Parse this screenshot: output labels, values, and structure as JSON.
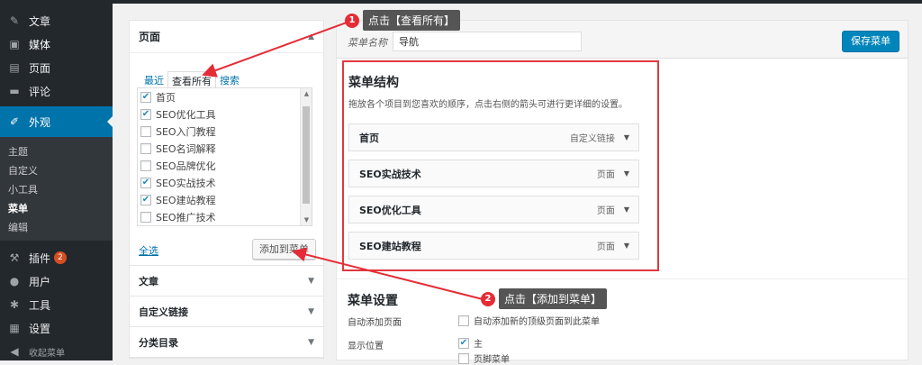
{
  "sidebar": {
    "items": [
      {
        "label": "文章",
        "icon": "pin-icon"
      },
      {
        "label": "媒体",
        "icon": "media-icon"
      },
      {
        "label": "页面",
        "icon": "page-icon"
      },
      {
        "label": "评论",
        "icon": "comment-icon"
      },
      {
        "label": "外观",
        "icon": "appearance-icon"
      }
    ],
    "submenu": [
      "主题",
      "自定义",
      "小工具",
      "菜单",
      "编辑"
    ],
    "after": [
      {
        "label": "插件",
        "icon": "plugin-icon",
        "badge": "2"
      },
      {
        "label": "用户",
        "icon": "user-icon"
      },
      {
        "label": "工具",
        "icon": "tool-icon"
      },
      {
        "label": "设置",
        "icon": "settings-icon"
      },
      {
        "label": "收起菜单",
        "icon": "collapse-icon"
      }
    ]
  },
  "pages_box": {
    "title": "页面",
    "tabs": [
      "最近",
      "查看所有",
      "搜索"
    ],
    "items": [
      {
        "label": "首页",
        "checked": true
      },
      {
        "label": "SEO优化工具",
        "checked": true
      },
      {
        "label": "SEO入门教程",
        "checked": false
      },
      {
        "label": "SEO名词解释",
        "checked": false
      },
      {
        "label": "SEO品牌优化",
        "checked": false
      },
      {
        "label": "SEO实战技术",
        "checked": true
      },
      {
        "label": "SEO建站教程",
        "checked": true
      },
      {
        "label": "SEO推广技术",
        "checked": false
      }
    ],
    "select_all": "全选",
    "add_button": "添加到菜单"
  },
  "sections": [
    "文章",
    "自定义链接",
    "分类目录"
  ],
  "editor": {
    "name_label": "菜单名称",
    "name_value": "导航",
    "save_button": "保存菜单",
    "structure_title": "菜单结构",
    "structure_desc": "拖放各个项目到您喜欢的顺序，点击右侧的箭头可进行更详细的设置。",
    "menu_items": [
      {
        "title": "首页",
        "type": "自定义链接"
      },
      {
        "title": "SEO实战技术",
        "type": "页面"
      },
      {
        "title": "SEO优化工具",
        "type": "页面"
      },
      {
        "title": "SEO建站教程",
        "type": "页面"
      }
    ],
    "settings_title": "菜单设置",
    "auto_add_label": "自动添加页面",
    "auto_add_option": "自动添加新的顶级页面到此菜单",
    "location_label": "显示位置",
    "location_main": "主",
    "location_footer": "页脚菜单"
  },
  "annotations": [
    {
      "num": "1",
      "text": "点击【查看所有】"
    },
    {
      "num": "2",
      "text": "点击【添加到菜单】"
    }
  ],
  "colors": {
    "accent": "#0073aa",
    "highlight": "#e0393e",
    "sidebar": "#23282d"
  }
}
